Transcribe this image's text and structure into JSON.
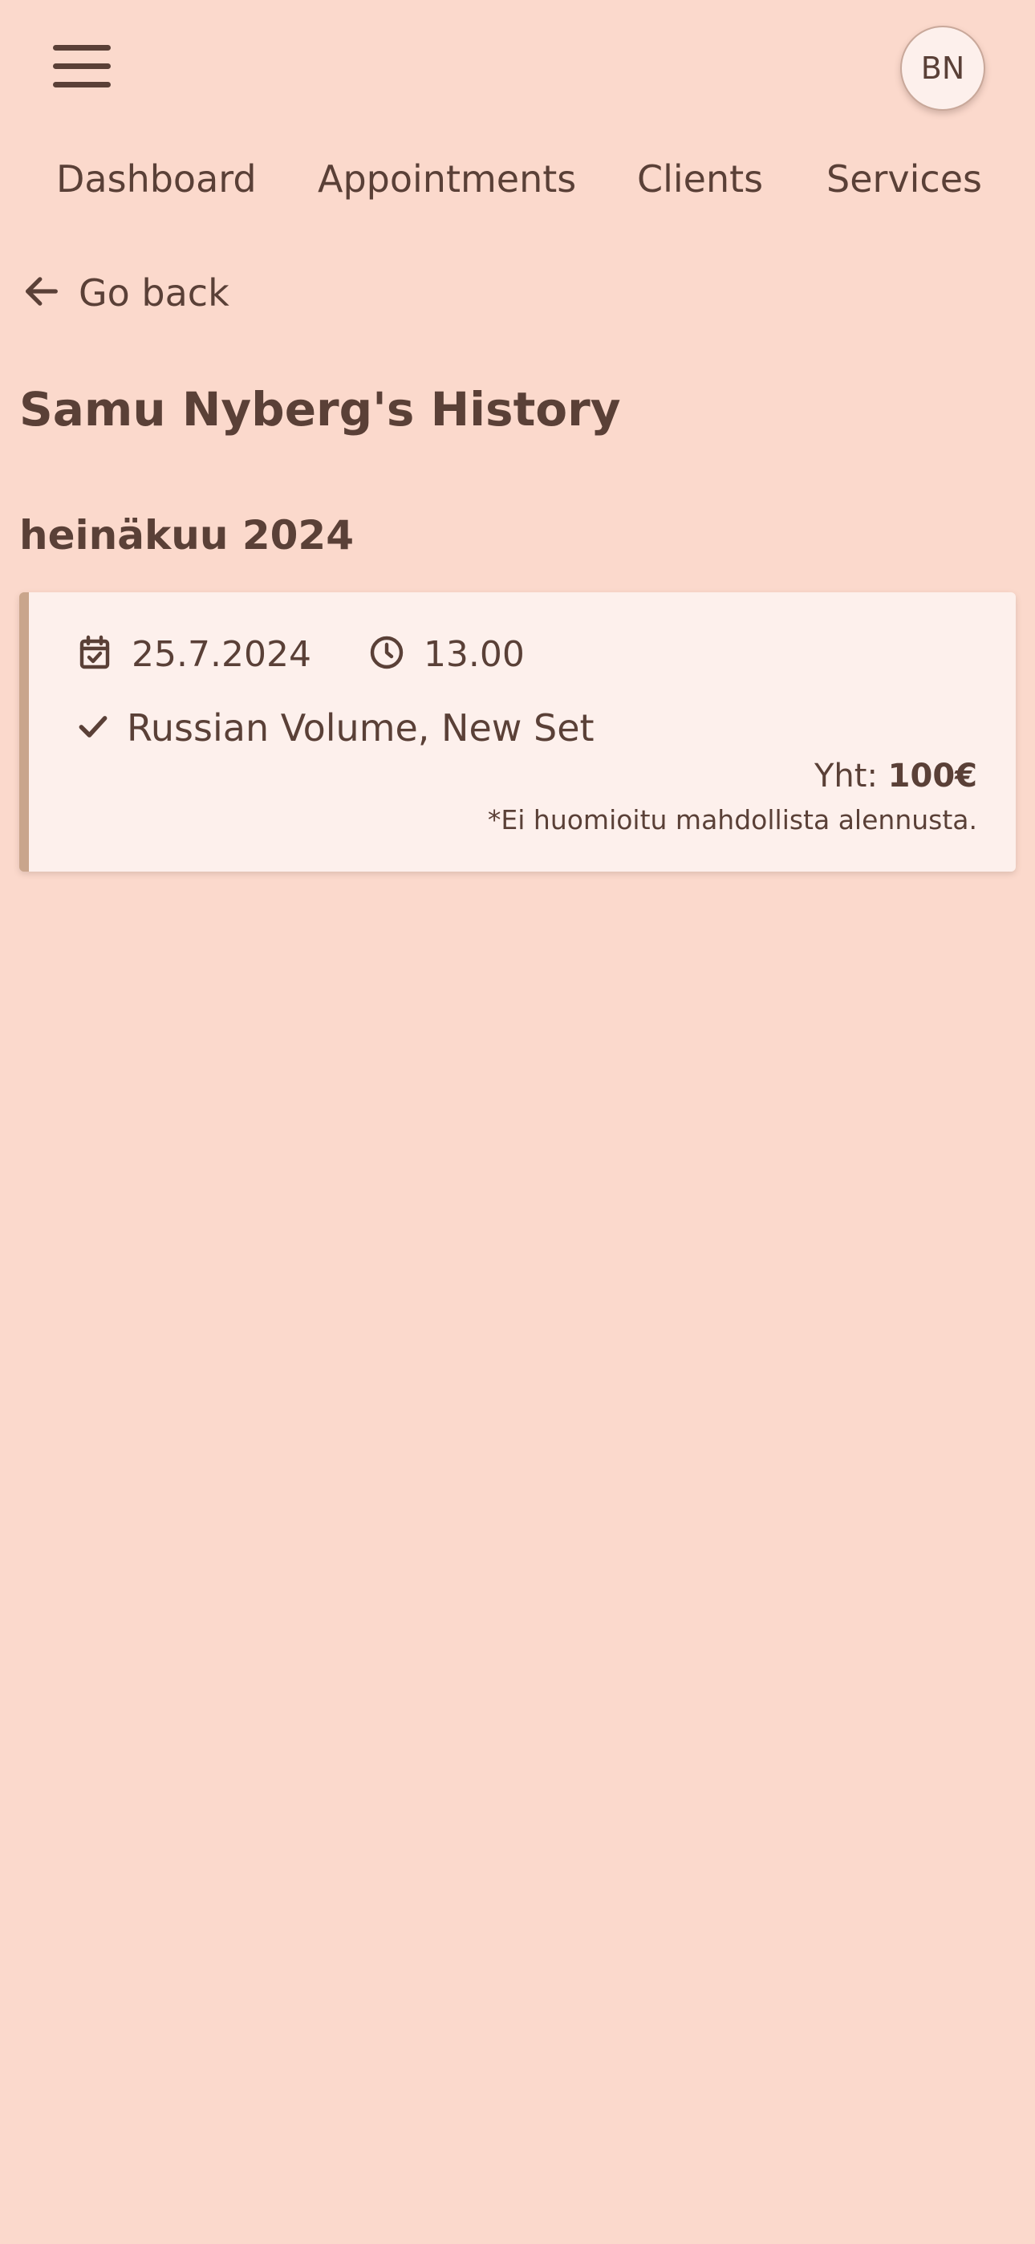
{
  "header": {
    "avatar_initials": "BN"
  },
  "nav": {
    "items": [
      {
        "label": "Dashboard"
      },
      {
        "label": "Appointments"
      },
      {
        "label": "Clients"
      },
      {
        "label": "Services"
      }
    ]
  },
  "back": {
    "label": "Go back"
  },
  "page": {
    "title": "Samu Nyberg's History"
  },
  "history": {
    "groups": [
      {
        "month": "heinäkuu 2024",
        "entries": [
          {
            "date": "25.7.2024",
            "time": "13.00",
            "service": "Russian Volume, New Set",
            "total_label": "Yht:",
            "total_amount": "100€",
            "note": "*Ei huomioitu mahdollista alennusta."
          }
        ]
      }
    ]
  },
  "icons": {
    "menu": "hamburger-menu-icon",
    "back": "arrow-left-icon",
    "date": "calendar-check-icon",
    "time": "clock-icon",
    "service": "check-icon"
  },
  "colors": {
    "background": "#fbd9cc",
    "text": "#5a4037",
    "card": "#fdf0ec",
    "card_accent": "#c9a58c"
  }
}
